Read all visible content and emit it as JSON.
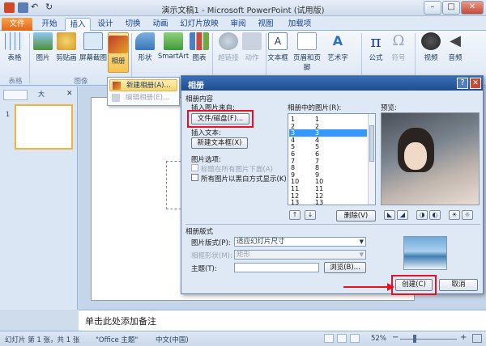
{
  "window": {
    "title": "演示文稿1 - Microsoft PowerPoint (试用版)"
  },
  "tabs": [
    {
      "label": "文件"
    },
    {
      "label": "开始"
    },
    {
      "label": "插入"
    },
    {
      "label": "设计"
    },
    {
      "label": "切换"
    },
    {
      "label": "动画"
    },
    {
      "label": "幻灯片放映"
    },
    {
      "label": "审阅"
    },
    {
      "label": "视图"
    },
    {
      "label": "加载项"
    }
  ],
  "ribbon": {
    "buttons": [
      "表格",
      "图片",
      "剪贴画",
      "屏幕截图",
      "相册",
      "形状",
      "SmartArt",
      "图表",
      "超链接",
      "动作",
      "文本框",
      "页眉和页脚",
      "艺术字",
      "公式",
      "符号",
      "视频",
      "音频"
    ],
    "groups": [
      "表格",
      "图像"
    ]
  },
  "album_menu": {
    "new": "新建相册(A)...",
    "edit": "编辑相册(E)..."
  },
  "pane": {
    "outline_tab": "大",
    "slide_number": "1"
  },
  "dialog": {
    "title": "相册",
    "album_content": "相册内容",
    "insert_from": "插入图片来自:",
    "file_disk_button": "文件/磁盘(F)...",
    "insert_text": "插入文本:",
    "new_textbox_button": "新建文本框(X)",
    "picture_options": "图片选项:",
    "captions_below": "标题在所有图片下面(A)",
    "all_black_white": "所有图片以黑白方式显示(K)",
    "pictures_in_album": "相册中的图片(R):",
    "picture_rows": [
      {
        "index": "1",
        "name": "1"
      },
      {
        "index": "2",
        "name": "2"
      },
      {
        "index": "3",
        "name": "3"
      },
      {
        "index": "4",
        "name": "4"
      },
      {
        "index": "5",
        "name": "5"
      },
      {
        "index": "6",
        "name": "6"
      },
      {
        "index": "7",
        "name": "7"
      },
      {
        "index": "8",
        "name": "8"
      },
      {
        "index": "9",
        "name": "9"
      },
      {
        "index": "10",
        "name": "10"
      },
      {
        "index": "11",
        "name": "11"
      },
      {
        "index": "12",
        "name": "12"
      },
      {
        "index": "13",
        "name": "13"
      }
    ],
    "selected_row_index": 2,
    "up_arrow": "↑",
    "down_arrow": "↓",
    "delete_button": "删除(V)",
    "preview": "预览:",
    "album_layout": "相册版式",
    "picture_layout_label": "图片版式(P):",
    "picture_layout_value": "适应幻灯片尺寸",
    "frame_shape_label": "相框形状(M):",
    "frame_shape_value": "矩形",
    "theme_label": "主题(T):",
    "theme_value": "",
    "browse_button": "浏览(B)...",
    "create_button": "创建(C)",
    "cancel_button": "取消"
  },
  "notes": {
    "placeholder": "单击此处添加备注"
  },
  "status": {
    "slide_info": "幻灯片 第 1 张，共 1 张",
    "theme": "\"Office 主题\"",
    "language": "中文(中国)",
    "zoom": "52%"
  },
  "colors": {
    "file_tab": "#e1661a",
    "title_bar": "#1e4d8f",
    "highlight": "#e81123",
    "selection": "#3399ff"
  }
}
